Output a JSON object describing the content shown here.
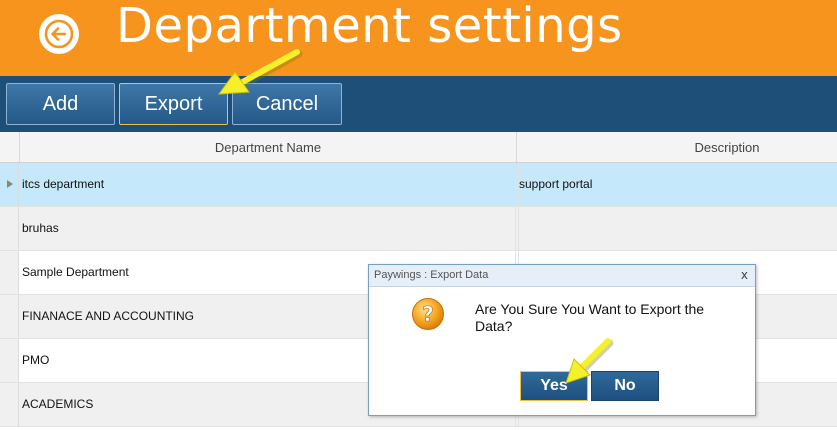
{
  "header": {
    "title": "Department settings",
    "background": "#f7941d",
    "back_icon": "back-arrow-icon"
  },
  "toolbar": {
    "add_label": "Add",
    "export_label": "Export",
    "cancel_label": "Cancel",
    "background": "#1e4f78"
  },
  "grid": {
    "columns": [
      "Department Name",
      "Description"
    ],
    "rows": [
      {
        "name": "itcs department",
        "description": "support portal",
        "selected": true
      },
      {
        "name": "bruhas",
        "description": ""
      },
      {
        "name": "Sample Department",
        "description": ""
      },
      {
        "name": "FINANACE AND ACCOUNTING",
        "description": ""
      },
      {
        "name": "PMO",
        "description": ""
      },
      {
        "name": "ACADEMICS",
        "description": ""
      }
    ]
  },
  "dialog": {
    "title": "Paywings : Export Data",
    "close": "x",
    "message": "Are You Sure You Want to Export the Data?",
    "yes_label": "Yes",
    "no_label": "No",
    "icon": "question-icon"
  },
  "annotations": {
    "pointer_color": "#f5f02a",
    "pointer_icon": "yellow-arrow-icon"
  }
}
